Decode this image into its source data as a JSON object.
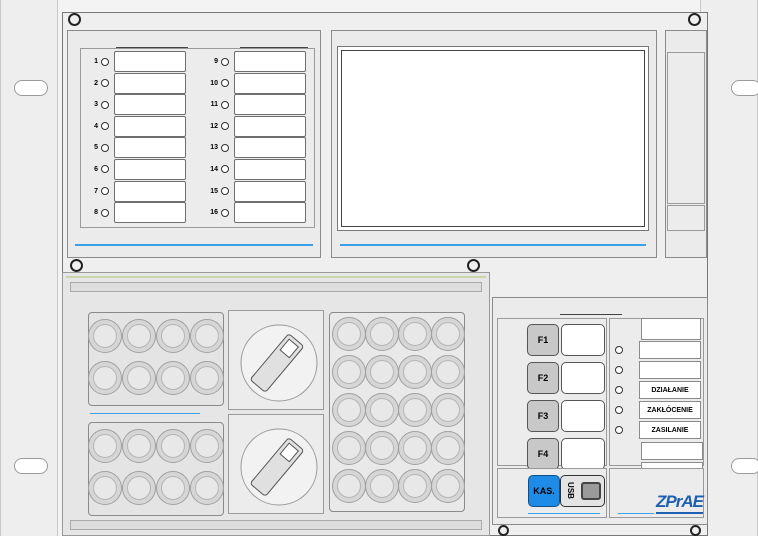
{
  "leds_left": [
    {
      "num": "1"
    },
    {
      "num": "2"
    },
    {
      "num": "3"
    },
    {
      "num": "4"
    },
    {
      "num": "5"
    },
    {
      "num": "6"
    },
    {
      "num": "7"
    },
    {
      "num": "8"
    }
  ],
  "leds_right": [
    {
      "num": "9"
    },
    {
      "num": "10"
    },
    {
      "num": "11"
    },
    {
      "num": "12"
    },
    {
      "num": "13"
    },
    {
      "num": "14"
    },
    {
      "num": "15"
    },
    {
      "num": "16"
    }
  ],
  "function_keys": [
    "F1",
    "F2",
    "F3",
    "F4"
  ],
  "status": {
    "dzialanie": "DZIAŁANIE",
    "zaklocenie": "ZAKŁÓCENIE",
    "zasilanie": "ZASILANIE"
  },
  "kas_label": "KAS.",
  "usb_label": "USB",
  "brand": "ZPrAE",
  "colors": {
    "accent_blue": "#3aa0e8",
    "kas_blue": "#1e8ce6"
  }
}
